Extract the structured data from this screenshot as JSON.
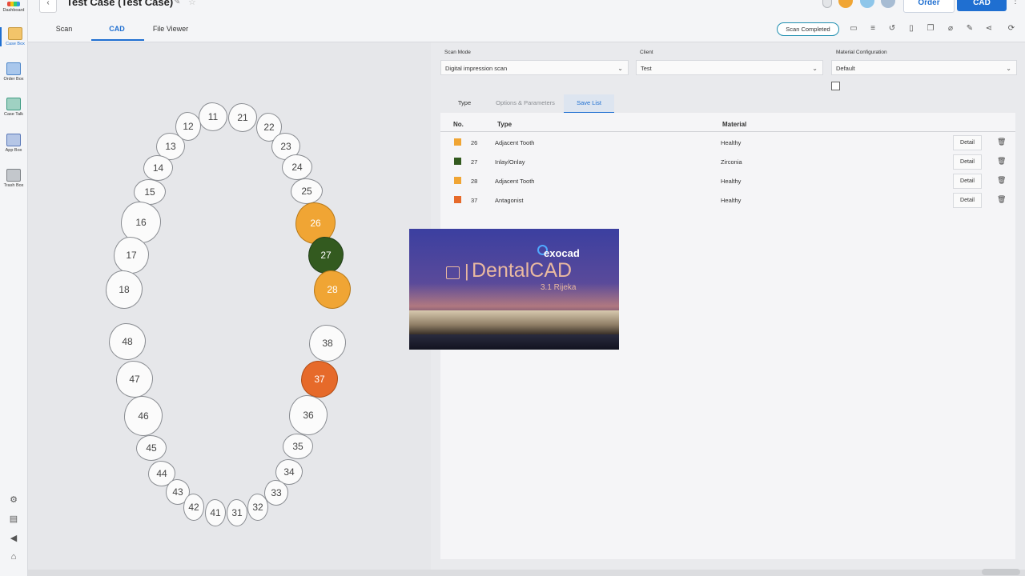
{
  "sidebar": {
    "items": [
      {
        "label": "Dashboard"
      },
      {
        "label": "Case Box"
      },
      {
        "label": "Order Box"
      },
      {
        "label": "Case Talk"
      },
      {
        "label": "App Box"
      },
      {
        "label": "Trash Box"
      }
    ],
    "bottom_icons": [
      "gear-icon",
      "book-icon",
      "megaphone-icon",
      "home-icon"
    ]
  },
  "header": {
    "title": "Test Case (Test Case)",
    "order_label": "Order",
    "cad_label": "CAD"
  },
  "tabs": [
    {
      "label": "Scan"
    },
    {
      "label": "CAD"
    },
    {
      "label": "File Viewer"
    }
  ],
  "toolbar": {
    "status": "Scan Completed",
    "icons": [
      "clipboard-icon",
      "note-icon",
      "history-icon",
      "trash-icon",
      "copy-icon",
      "attach-icon",
      "edit-icon",
      "share-icon",
      "refresh-icon"
    ]
  },
  "teeth": [
    "11",
    "21",
    "12",
    "22",
    "13",
    "23",
    "14",
    "24",
    "15",
    "25",
    "16",
    "26",
    "17",
    "27",
    "18",
    "28",
    "48",
    "38",
    "47",
    "37",
    "46",
    "36",
    "45",
    "35",
    "44",
    "34",
    "43",
    "33",
    "42",
    "32",
    "41",
    "31"
  ],
  "form": {
    "scan_mode_label": "Scan Mode",
    "scan_mode_value": "Digital impression scan",
    "client_label": "Client",
    "client_value": "Test",
    "material_config_label": "Material Configuration",
    "material_config_value": "Default"
  },
  "subtabs": [
    {
      "label": "Type"
    },
    {
      "label": "Options & Parameters"
    },
    {
      "label": "Save List"
    }
  ],
  "table": {
    "headers": {
      "no": "No.",
      "type": "Type",
      "material": "Material"
    },
    "detail_label": "Detail",
    "rows": [
      {
        "no": "26",
        "type": "Adjacent Tooth",
        "material": "Healthy",
        "color": "#f0a534"
      },
      {
        "no": "27",
        "type": "Inlay/Onlay",
        "material": "Zirconia",
        "color": "#335a1f"
      },
      {
        "no": "28",
        "type": "Adjacent Tooth",
        "material": "Healthy",
        "color": "#f0a534"
      },
      {
        "no": "37",
        "type": "Antagonist",
        "material": "Healthy",
        "color": "#e66a2a"
      }
    ]
  },
  "splash": {
    "brand": "exocad",
    "product": "DentalCAD",
    "version": "3.1 Rijeka"
  },
  "colors": {
    "accent": "#1f6fd1",
    "adjacent": "#f0a534",
    "restoration": "#335a1f",
    "antagonist": "#e66a2a"
  }
}
